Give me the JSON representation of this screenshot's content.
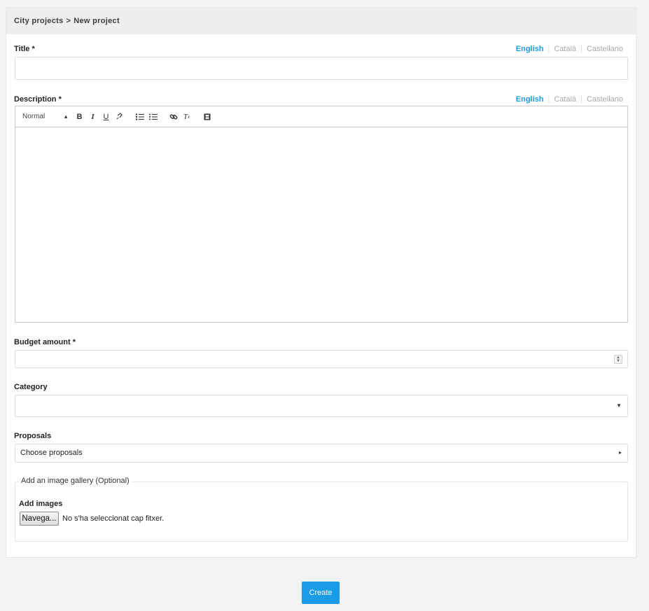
{
  "breadcrumb": {
    "parent": "City projects",
    "separator": ">",
    "current": "New project"
  },
  "languages": [
    "English",
    "Català",
    "Castellano"
  ],
  "fields": {
    "title": {
      "label": "Title *",
      "value": ""
    },
    "description": {
      "label": "Description *",
      "format_select": "Normal",
      "toolbar": [
        "bold-icon",
        "italic-icon",
        "underline-icon",
        "link-break-icon",
        "ordered-list-icon",
        "bullet-list-icon",
        "link-icon",
        "clear-format-icon",
        "video-icon"
      ]
    },
    "budget": {
      "label": "Budget amount *",
      "value": ""
    },
    "category": {
      "label": "Category",
      "value": ""
    },
    "proposals": {
      "label": "Proposals",
      "placeholder": "Choose proposals"
    }
  },
  "gallery": {
    "legend": "Add an image gallery (Optional)",
    "label": "Add images",
    "browse_label": "Navega...",
    "status": "No s'ha seleccionat cap fitxer."
  },
  "actions": {
    "create_label": "Create"
  },
  "colors": {
    "accent": "#1a9be6",
    "active_lang": "#1a9be0"
  }
}
